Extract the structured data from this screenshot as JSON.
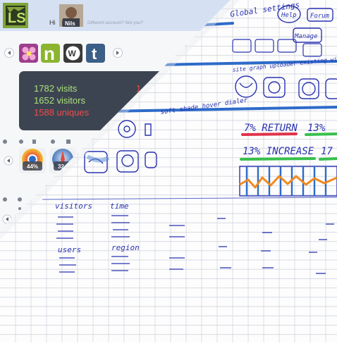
{
  "header": {
    "greeting": "Hi",
    "user_name": "Nils",
    "account_link": "Different account? Not you?"
  },
  "carousel": {
    "prev_icon": "chevron-left-icon",
    "next_icon": "chevron-right-icon",
    "apps": [
      {
        "name": "flower-app-icon"
      },
      {
        "name": "n-app-icon",
        "glyph": "n"
      },
      {
        "name": "wordpress-icon",
        "glyph": "W"
      },
      {
        "name": "tumblr-icon",
        "glyph": "t"
      }
    ]
  },
  "stats": {
    "visits": "1782 visits",
    "visitors": "1652 visitors",
    "uniques": "1588 uniques",
    "clipped_value": "1"
  },
  "browsers": {
    "chrome_percent": "44%",
    "safari_percent": "32"
  },
  "sketch": {
    "top_labels": [
      "Global settings",
      "Help",
      "Forum",
      "Manage"
    ],
    "plugin_note": "site graph uploader existing widget",
    "hover_note": "soft shade hover dialer",
    "return_stat": "7% RETURN",
    "pct_stat": "13%",
    "increase_stat": "13% INCREASE",
    "increase_stat2": "17",
    "visitors_label": "visitors",
    "time_label": "time",
    "users_label": "users",
    "region_label": "region"
  },
  "colors": {
    "header_bg": "#d5e1f3",
    "stats_panel": "#3d4451",
    "visits_green": "#a8e07a",
    "uniques_red": "#f04a4a",
    "ink_blue": "#2a33b0",
    "marker_blue": "#2e6bc9",
    "marker_red": "#e0324a",
    "marker_green": "#39c04c",
    "marker_orange": "#f08a1e"
  }
}
